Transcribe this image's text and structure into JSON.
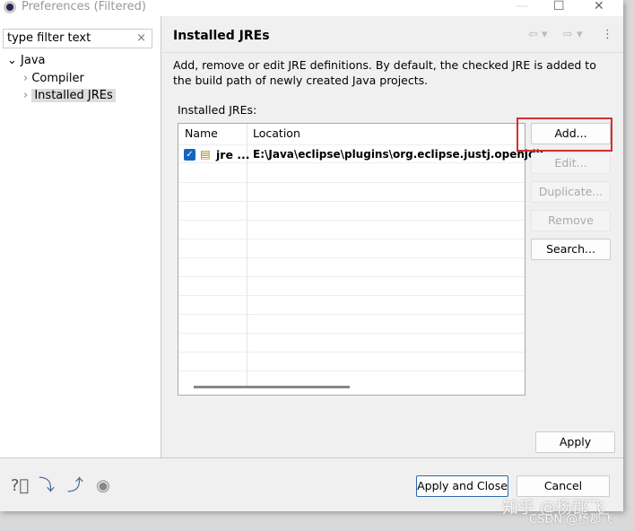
{
  "window": {
    "title": "Preferences (Filtered)"
  },
  "filter": {
    "placeholder": "type filter text",
    "clear": "×"
  },
  "tree": {
    "root": "Java",
    "items": [
      "Compiler",
      "Installed JREs"
    ],
    "selected": "Installed JREs"
  },
  "page": {
    "title": "Installed JREs",
    "description": "Add, remove or edit JRE definitions. By default, the checked JRE is added to the build path of newly created Java projects.",
    "table_label": "Installed JREs:"
  },
  "table": {
    "columns": [
      "Name",
      "Location"
    ],
    "rows": [
      {
        "checked": true,
        "name": "jre ...",
        "location": "E:\\Java\\eclipse\\plugins\\org.eclipse.justj.openjdk."
      }
    ]
  },
  "buttons": {
    "add": "Add...",
    "edit": "Edit...",
    "duplicate": "Duplicate...",
    "remove": "Remove",
    "search": "Search...",
    "apply": "Apply",
    "apply_close": "Apply and Close",
    "cancel": "Cancel"
  },
  "watermark": {
    "line1": "知乎 @杨郡飞",
    "line2": "CSDN @杨郡飞"
  },
  "colors": {
    "highlight": "#d03030",
    "checkbox": "#1565c0"
  }
}
